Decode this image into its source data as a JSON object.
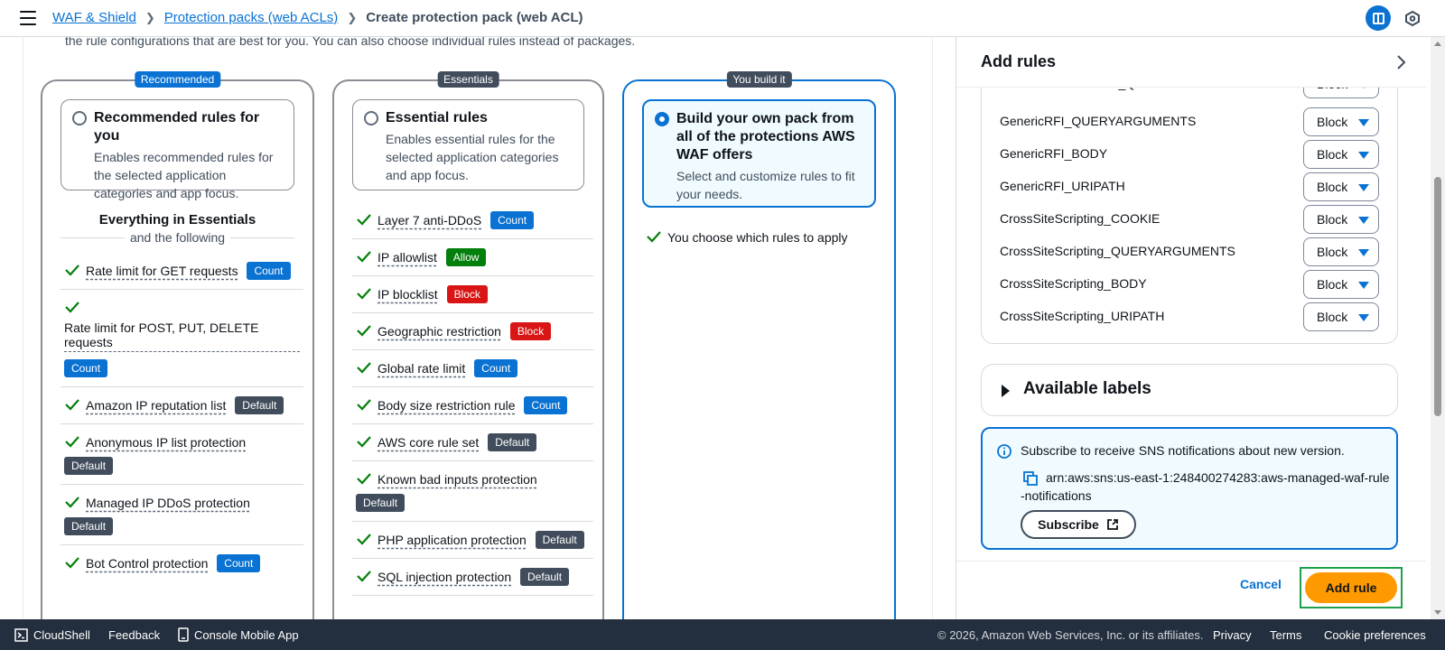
{
  "breadcrumbs": {
    "first": "WAF & Shield",
    "second": "Protection packs (web ACLs)",
    "current": "Create protection pack (web ACL)"
  },
  "intro_text": "the rule configurations that are best for you. You can also choose individual rules instead of packages.",
  "columns": {
    "recommended": {
      "badge": "Recommended",
      "title": "Recommended rules for you",
      "description": "Enables recommended rules for the selected application categories and app focus.",
      "heading": "Everything in Essentials",
      "subheading": "and the following",
      "features": [
        {
          "name": "Rate limit for GET requests",
          "tag": "Count"
        },
        {
          "name": "Rate limit for POST, PUT, DELETE requests",
          "tag": "Count"
        },
        {
          "name": "Amazon IP reputation list",
          "tag": "Default"
        },
        {
          "name": "Anonymous IP list protection",
          "tag": "Default"
        },
        {
          "name": "Managed IP DDoS protection",
          "tag": "Default"
        },
        {
          "name": "Bot Control protection",
          "tag": "Count"
        }
      ]
    },
    "essentials": {
      "badge": "Essentials",
      "title": "Essential rules",
      "description": "Enables essential rules for the selected application categories and app focus.",
      "features": [
        {
          "name": "Layer 7 anti-DDoS",
          "tag": "Count"
        },
        {
          "name": "IP allowlist",
          "tag": "Allow"
        },
        {
          "name": "IP blocklist",
          "tag": "Block"
        },
        {
          "name": "Geographic restriction",
          "tag": "Block"
        },
        {
          "name": "Global rate limit",
          "tag": "Count"
        },
        {
          "name": "Body size restriction rule",
          "tag": "Count"
        },
        {
          "name": "AWS core rule set",
          "tag": "Default"
        },
        {
          "name": "Known bad inputs protection",
          "tag": "Default"
        },
        {
          "name": "PHP application protection",
          "tag": "Default"
        },
        {
          "name": "SQL injection protection",
          "tag": "Default"
        }
      ]
    },
    "custom": {
      "badge": "You build it",
      "title": "Build your own pack from all of the protections AWS WAF offers",
      "description": "Select and customize rules to fit your needs.",
      "features": [
        {
          "name": "You choose which rules to apply"
        }
      ]
    }
  },
  "panel": {
    "title": "Add rules",
    "rules": [
      {
        "name": "RestrictedExtensions_QUERYARGUMENTS",
        "action": "Block"
      },
      {
        "name": "GenericRFI_QUERYARGUMENTS",
        "action": "Block"
      },
      {
        "name": "GenericRFI_BODY",
        "action": "Block"
      },
      {
        "name": "GenericRFI_URIPATH",
        "action": "Block"
      },
      {
        "name": "CrossSiteScripting_COOKIE",
        "action": "Block"
      },
      {
        "name": "CrossSiteScripting_QUERYARGUMENTS",
        "action": "Block"
      },
      {
        "name": "CrossSiteScripting_BODY",
        "action": "Block"
      },
      {
        "name": "CrossSiteScripting_URIPATH",
        "action": "Block"
      }
    ],
    "available_labels": "Available labels",
    "info": {
      "text": "Subscribe to receive SNS notifications about new version.",
      "arn": "arn:aws:sns:us-east-1:248400274283:aws-managed-waf-rule-notifications",
      "subscribe_label": "Subscribe"
    },
    "cancel_label": "Cancel",
    "add_rule_label": "Add rule"
  },
  "footer": {
    "cloudshell": "CloudShell",
    "feedback": "Feedback",
    "mobile_app": "Console Mobile App",
    "copyright": "© 2026, Amazon Web Services, Inc. or its affiliates.",
    "privacy": "Privacy",
    "terms": "Terms",
    "cookies": "Cookie preferences"
  },
  "colors": {
    "accent": "#0972d3",
    "count": "#0972d3",
    "allow": "#037f0c",
    "block": "#d91515",
    "default": "#414d5c",
    "primary_button": "#ff9900",
    "footer_bg": "#232f3e"
  },
  "icons": [
    "menu-icon",
    "panel-toggle-icon",
    "hexagon-settings-icon",
    "check-icon",
    "chevron-right-icon",
    "caret-down-icon",
    "info-icon",
    "copy-icon",
    "external-link-icon",
    "cloudshell-icon",
    "mobile-app-icon"
  ]
}
